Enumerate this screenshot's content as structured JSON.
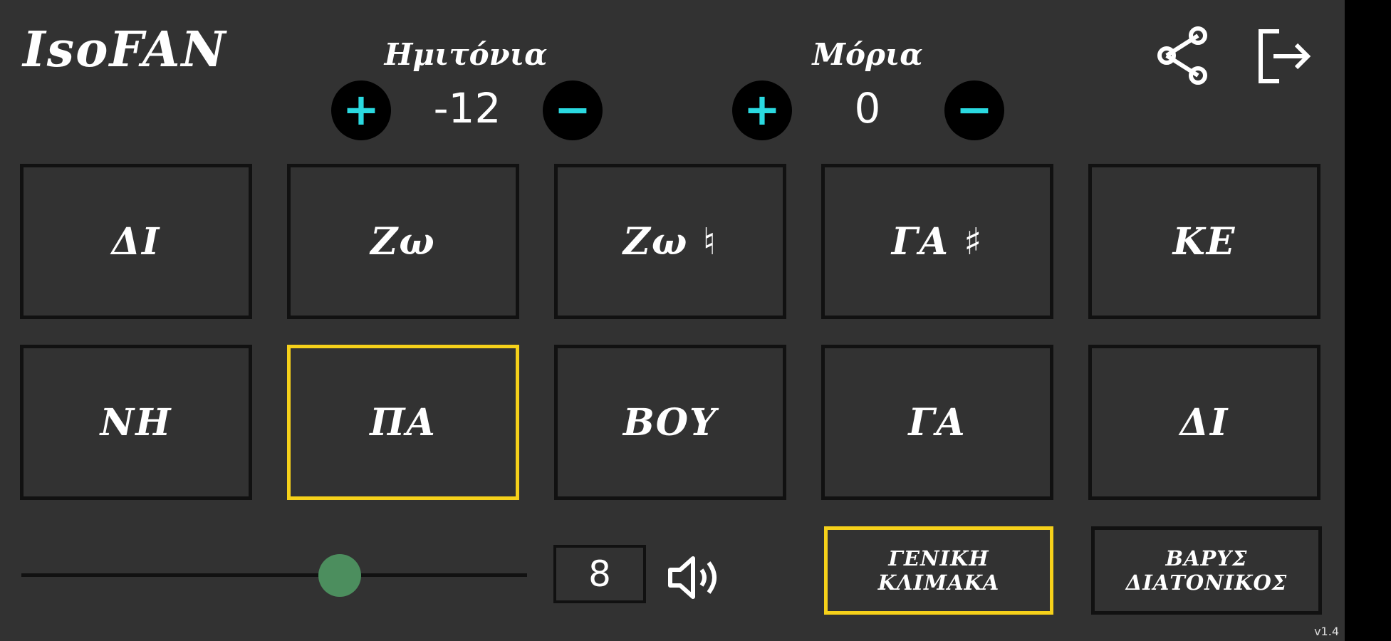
{
  "app": {
    "title": "IsoFAN",
    "version": "v1.4"
  },
  "semitones": {
    "label": "Ημιτόνια",
    "value": "-12",
    "plus": "+",
    "minus": "−"
  },
  "moria": {
    "label": "Μόρια",
    "value": "0",
    "plus": "+",
    "minus": "−"
  },
  "icons": {
    "share": "share-icon",
    "exit": "exit-icon",
    "volume": "speaker-icon"
  },
  "notes_row1": [
    {
      "label": "ΔΙ",
      "selected": false
    },
    {
      "label": "Ζω",
      "selected": false
    },
    {
      "label": "Ζω ♮",
      "selected": false
    },
    {
      "label": "ΓΑ ♯",
      "selected": false
    },
    {
      "label": "ΚΕ",
      "selected": false
    }
  ],
  "notes_row2": [
    {
      "label": "ΝΗ",
      "selected": false
    },
    {
      "label": "ΠΑ",
      "selected": true
    },
    {
      "label": "ΒΟΥ",
      "selected": false
    },
    {
      "label": "ΓΑ",
      "selected": false
    },
    {
      "label": "ΔΙ",
      "selected": false
    }
  ],
  "volume": {
    "value": "8",
    "slider_fraction": 0.63
  },
  "scales": [
    {
      "line1": "ΓΕΝΙΚΗ",
      "line2": "ΚΛΙΜΑΚΑ",
      "selected": true
    },
    {
      "line1": "ΒΑΡΥΣ",
      "line2": "ΔΙΑΤΟΝΙΚΟΣ",
      "selected": false
    }
  ],
  "colors": {
    "accent": "#2ad9e0",
    "selected_border": "#f6d11a",
    "slider_thumb": "#4c8e5e",
    "background": "#323232"
  }
}
